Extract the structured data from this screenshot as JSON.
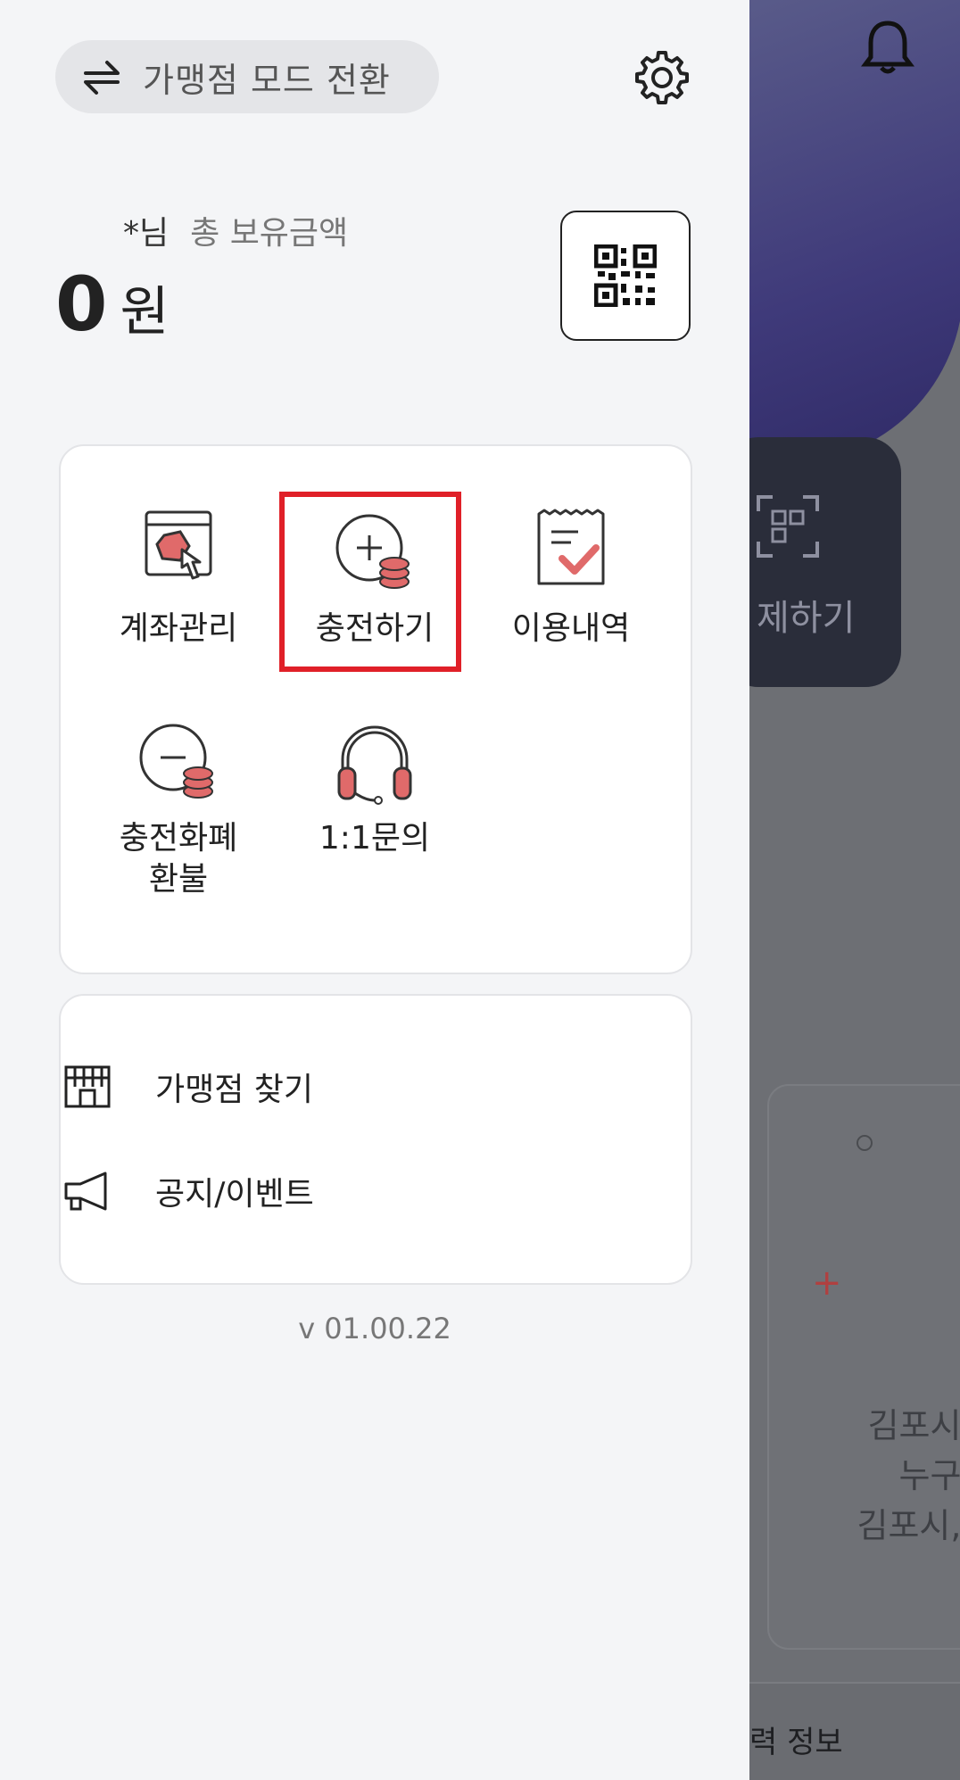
{
  "drawer": {
    "mode_switch_label": "가맹점 모드 전환",
    "user_name": "*님",
    "balance_caption": "총 보유금액",
    "balance_amount": "0",
    "balance_unit": "원",
    "menu": [
      {
        "label": "계좌관리",
        "icon": "account-manage-icon"
      },
      {
        "label": "충전하기",
        "icon": "charge-coin-icon",
        "highlighted": true
      },
      {
        "label": "이용내역",
        "icon": "receipt-check-icon"
      },
      {
        "label": "충전화폐\n환불",
        "icon": "refund-coin-icon"
      },
      {
        "label": "1:1문의",
        "icon": "headset-icon"
      }
    ],
    "list": [
      {
        "label": "가맹점 찾기",
        "icon": "store-icon"
      },
      {
        "label": "공지/이벤트",
        "icon": "megaphone-icon"
      }
    ],
    "version": "v 01.00.22",
    "highlight_color": "#e02028"
  },
  "background": {
    "pay_label": "제하기",
    "card_text": "김포시민이\n누구나\n김포시, 김포",
    "bottom_label": "력 정보"
  }
}
